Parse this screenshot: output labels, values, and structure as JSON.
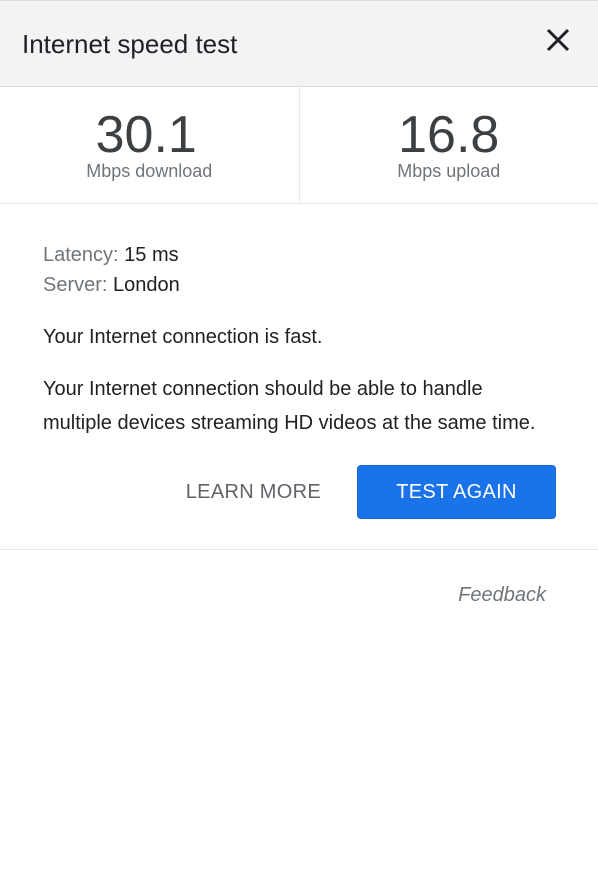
{
  "header": {
    "title": "Internet speed test",
    "close_icon": "close-icon"
  },
  "results": {
    "download": {
      "value": "30.1",
      "unit": "Mbps download"
    },
    "upload": {
      "value": "16.8",
      "unit": "Mbps upload"
    }
  },
  "details": {
    "latency_label": "Latency:",
    "latency_value": "15 ms",
    "server_label": "Server:",
    "server_value": "London"
  },
  "verdict": "Your Internet connection is fast.",
  "description": "Your Internet connection should be able to handle multiple devices streaming HD videos at the same time.",
  "actions": {
    "learn_more": "LEARN MORE",
    "test_again": "TEST AGAIN"
  },
  "feedback": "Feedback",
  "colors": {
    "accent": "#1a73e8",
    "header_bg": "#f1f3f4",
    "muted_text": "#70757a"
  }
}
